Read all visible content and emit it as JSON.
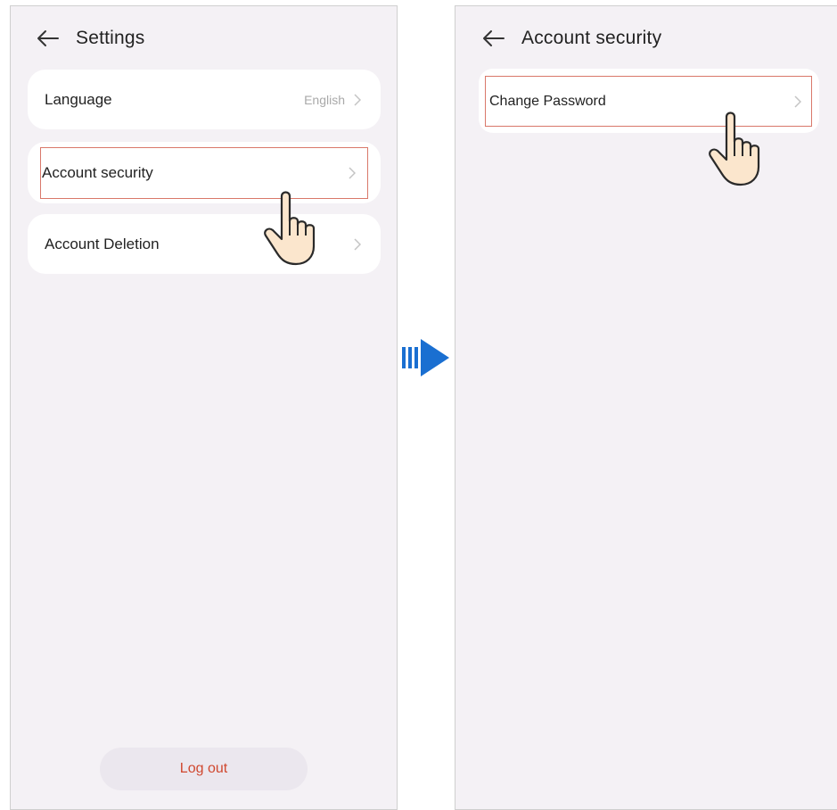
{
  "left_screen": {
    "title": "Settings",
    "items": [
      {
        "label": "Language",
        "value": "English"
      },
      {
        "label": "Account security"
      },
      {
        "label": "Account Deletion"
      }
    ],
    "logout_label": "Log out"
  },
  "right_screen": {
    "title": "Account security",
    "items": [
      {
        "label": "Change Password"
      }
    ]
  },
  "colors": {
    "background": "#f4f1f5",
    "card": "#ffffff",
    "highlight_border": "#d9786a",
    "logout_text": "#d0482f",
    "arrow": "#1a6fd1"
  },
  "icons": {
    "back": "back-arrow-icon",
    "chevron": "chevron-right-icon",
    "pointer": "pointing-hand-icon",
    "transition": "arrow-right-icon"
  }
}
